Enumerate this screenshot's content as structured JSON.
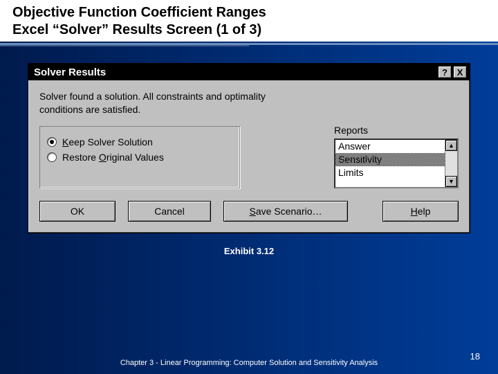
{
  "slide": {
    "title_line1": "Objective Function Coefficient Ranges",
    "title_line2": "Excel “Solver” Results Screen (1 of 3)"
  },
  "dialog": {
    "title": "Solver Results",
    "help_btn": "?",
    "close_btn": "X",
    "message_line1": "Solver found a solution.  All constraints and optimality",
    "message_line2": "conditions are satisfied.",
    "radio_keep_prefix": "K",
    "radio_keep_rest": "eep Solver Solution",
    "radio_restore_before": "Restore ",
    "radio_restore_ul": "O",
    "radio_restore_after": "riginal Values",
    "reports_label": "Reports",
    "reports": {
      "items": [
        "Answer",
        "Sensitivity",
        "Limits"
      ],
      "selected_index": 1
    },
    "buttons": {
      "ok": "OK",
      "cancel": "Cancel",
      "save_ul": "S",
      "save_rest": "ave Scenario…",
      "help_ul": "H",
      "help_rest": "elp"
    },
    "scroll_up": "▲",
    "scroll_down": "▼"
  },
  "exhibit": "Exhibit 3.12",
  "footer": "Chapter 3 - Linear Programming:  Computer Solution and Sensitivity Analysis",
  "page": "18"
}
